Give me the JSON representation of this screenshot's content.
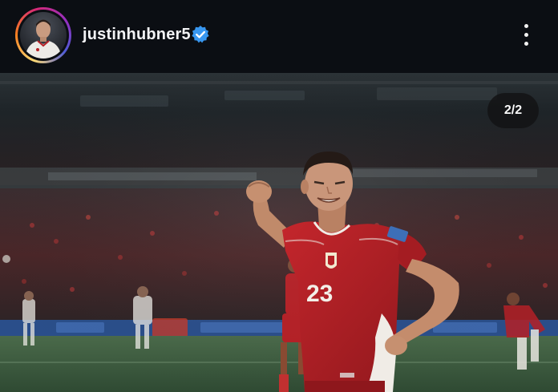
{
  "header": {
    "username": "justinhubner5",
    "verified_icon": "verified-badge-icon",
    "menu_icon": "more-vertical-icon"
  },
  "carousel": {
    "counter": "2/2",
    "current": 2,
    "total": 2
  },
  "photo": {
    "player_number": "23"
  },
  "colors": {
    "header_bg": "#0b0e13",
    "verified_blue": "#3897f0",
    "jersey_red": "#b52026",
    "pitch_green": "#3c5a3c"
  }
}
